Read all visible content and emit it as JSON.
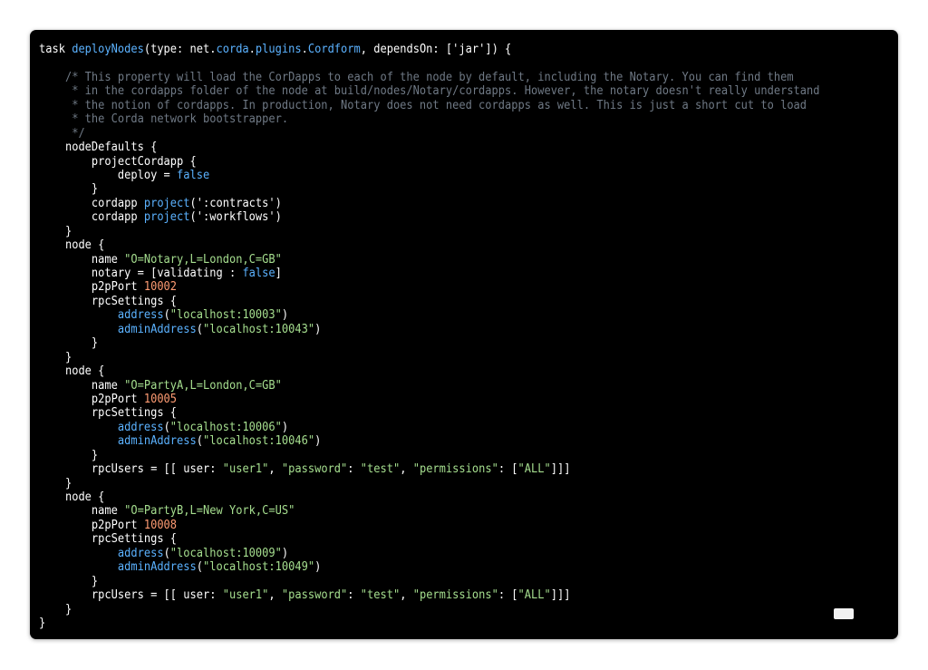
{
  "code": {
    "lines": [
      [
        [
          "text",
          "task "
        ],
        [
          "kw",
          "deployNodes"
        ],
        [
          "text",
          "(type: net."
        ],
        [
          "kw",
          "corda"
        ],
        [
          "text",
          "."
        ],
        [
          "kw",
          "plugins"
        ],
        [
          "text",
          "."
        ],
        [
          "kw",
          "Cordform"
        ],
        [
          "text",
          ", dependsOn: ['jar']) {"
        ]
      ],
      [],
      [
        [
          "comment",
          "    /* This property will load the CorDapps to each of the node by default, including the Notary. You can find them"
        ]
      ],
      [
        [
          "comment",
          "     * in the cordapps folder of the node at build/nodes/Notary/cordapps. However, the notary doesn't really understand"
        ]
      ],
      [
        [
          "comment",
          "     * the notion of cordapps. In production, Notary does not need cordapps as well. This is just a short cut to load"
        ]
      ],
      [
        [
          "comment",
          "     * the Corda network bootstrapper."
        ]
      ],
      [
        [
          "comment",
          "     */"
        ]
      ],
      [
        [
          "text",
          "    nodeDefaults {"
        ]
      ],
      [
        [
          "text",
          "        projectCordapp {"
        ]
      ],
      [
        [
          "text",
          "            deploy = "
        ],
        [
          "kw",
          "false"
        ]
      ],
      [
        [
          "text",
          "        }"
        ]
      ],
      [
        [
          "text",
          "        cordapp "
        ],
        [
          "kw",
          "project"
        ],
        [
          "text",
          "(':contracts')"
        ]
      ],
      [
        [
          "text",
          "        cordapp "
        ],
        [
          "kw",
          "project"
        ],
        [
          "text",
          "(':workflows')"
        ]
      ],
      [
        [
          "text",
          "    }"
        ]
      ],
      [
        [
          "text",
          "    node {"
        ]
      ],
      [
        [
          "text",
          "        name "
        ],
        [
          "str",
          "\"O=Notary,L=London,C=GB\""
        ]
      ],
      [
        [
          "text",
          "        notary = [validating : "
        ],
        [
          "kw",
          "false"
        ],
        [
          "text",
          "]"
        ]
      ],
      [
        [
          "text",
          "        p2pPort "
        ],
        [
          "num",
          "10002"
        ]
      ],
      [
        [
          "text",
          "        rpcSettings {"
        ]
      ],
      [
        [
          "text",
          "            "
        ],
        [
          "kw",
          "address"
        ],
        [
          "text",
          "("
        ],
        [
          "str",
          "\"localhost:10003\""
        ],
        [
          "text",
          ")"
        ]
      ],
      [
        [
          "text",
          "            "
        ],
        [
          "kw",
          "adminAddress"
        ],
        [
          "text",
          "("
        ],
        [
          "str",
          "\"localhost:10043\""
        ],
        [
          "text",
          ")"
        ]
      ],
      [
        [
          "text",
          "        }"
        ]
      ],
      [
        [
          "text",
          "    }"
        ]
      ],
      [
        [
          "text",
          "    node {"
        ]
      ],
      [
        [
          "text",
          "        name "
        ],
        [
          "str",
          "\"O=PartyA,L=London,C=GB\""
        ]
      ],
      [
        [
          "text",
          "        p2pPort "
        ],
        [
          "num",
          "10005"
        ]
      ],
      [
        [
          "text",
          "        rpcSettings {"
        ]
      ],
      [
        [
          "text",
          "            "
        ],
        [
          "kw",
          "address"
        ],
        [
          "text",
          "("
        ],
        [
          "str",
          "\"localhost:10006\""
        ],
        [
          "text",
          ")"
        ]
      ],
      [
        [
          "text",
          "            "
        ],
        [
          "kw",
          "adminAddress"
        ],
        [
          "text",
          "("
        ],
        [
          "str",
          "\"localhost:10046\""
        ],
        [
          "text",
          ")"
        ]
      ],
      [
        [
          "text",
          "        }"
        ]
      ],
      [
        [
          "text",
          "        rpcUsers = [[ user: "
        ],
        [
          "str",
          "\"user1\""
        ],
        [
          "text",
          ", "
        ],
        [
          "str",
          "\"password\""
        ],
        [
          "text",
          ": "
        ],
        [
          "str",
          "\"test\""
        ],
        [
          "text",
          ", "
        ],
        [
          "str",
          "\"permissions\""
        ],
        [
          "text",
          ": ["
        ],
        [
          "str",
          "\"ALL\""
        ],
        [
          "text",
          "]]]"
        ]
      ],
      [
        [
          "text",
          "    }"
        ]
      ],
      [
        [
          "text",
          "    node {"
        ]
      ],
      [
        [
          "text",
          "        name "
        ],
        [
          "str",
          "\"O=PartyB,L=New York,C=US\""
        ]
      ],
      [
        [
          "text",
          "        p2pPort "
        ],
        [
          "num",
          "10008"
        ]
      ],
      [
        [
          "text",
          "        rpcSettings {"
        ]
      ],
      [
        [
          "text",
          "            "
        ],
        [
          "kw",
          "address"
        ],
        [
          "text",
          "("
        ],
        [
          "str",
          "\"localhost:10009\""
        ],
        [
          "text",
          ")"
        ]
      ],
      [
        [
          "text",
          "            "
        ],
        [
          "kw",
          "adminAddress"
        ],
        [
          "text",
          "("
        ],
        [
          "str",
          "\"localhost:10049\""
        ],
        [
          "text",
          ")"
        ]
      ],
      [
        [
          "text",
          "        }"
        ]
      ],
      [
        [
          "text",
          "        rpcUsers = [[ user: "
        ],
        [
          "str",
          "\"user1\""
        ],
        [
          "text",
          ", "
        ],
        [
          "str",
          "\"password\""
        ],
        [
          "text",
          ": "
        ],
        [
          "str",
          "\"test\""
        ],
        [
          "text",
          ", "
        ],
        [
          "str",
          "\"permissions\""
        ],
        [
          "text",
          ": ["
        ],
        [
          "str",
          "\"ALL\""
        ],
        [
          "text",
          "]]]"
        ]
      ],
      [
        [
          "text",
          "    }"
        ]
      ],
      [
        [
          "text",
          "}"
        ]
      ]
    ]
  }
}
